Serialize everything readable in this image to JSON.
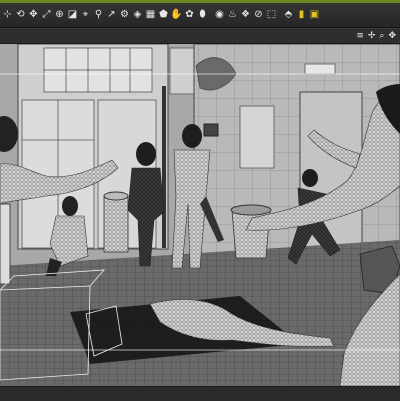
{
  "toolbar": {
    "tools": [
      {
        "name": "node-selection-tool",
        "glyph": "⊹"
      },
      {
        "name": "rotate-tool",
        "glyph": "⟲"
      },
      {
        "name": "translate-tool",
        "glyph": "✥"
      },
      {
        "name": "scale-tool",
        "glyph": "⤢"
      },
      {
        "name": "universal-tool",
        "glyph": "⊕"
      },
      {
        "name": "surface-selection-tool",
        "glyph": "◪"
      },
      {
        "name": "region-navigator-tool",
        "glyph": "⌖"
      },
      {
        "name": "active-pose-tool",
        "glyph": "⚲"
      },
      {
        "name": "pose-tool",
        "glyph": "↗"
      },
      {
        "name": "joint-editor-tool",
        "glyph": "⚙"
      },
      {
        "name": "geometry-editor-tool",
        "glyph": "◈"
      },
      {
        "name": "weight-map-tool",
        "glyph": "▦"
      },
      {
        "name": "morph-tool",
        "glyph": "⬟"
      },
      {
        "name": "spot-render-tool",
        "glyph": "✋"
      },
      {
        "name": "light-tool",
        "glyph": "✿"
      },
      {
        "name": "camera-tool",
        "glyph": "⬮"
      },
      {
        "name": "sphere-primitive-tool",
        "glyph": "◉"
      },
      {
        "name": "scene-tool",
        "glyph": "♨"
      },
      {
        "name": "render-tool",
        "glyph": "❖"
      },
      {
        "name": "gizmo-tool",
        "glyph": "⊘"
      },
      {
        "name": "render-settings-tool",
        "glyph": "⬚"
      },
      {
        "name": "save-tool",
        "glyph": "⬘"
      },
      {
        "name": "lock-tool",
        "glyph": "▮",
        "yellow": true
      },
      {
        "name": "camera-lock-tool",
        "glyph": "▣",
        "yellow": true
      }
    ]
  },
  "viewport_controls": [
    {
      "name": "viewport-menu-icon",
      "glyph": "≡"
    },
    {
      "name": "orbit-icon",
      "glyph": "✢"
    },
    {
      "name": "zoom-icon",
      "glyph": "⌕"
    },
    {
      "name": "pan-icon",
      "glyph": "✥"
    }
  ],
  "colors": {
    "accent": "#6b8a1f",
    "selection_yellow": "#e4c21d",
    "toolbar_bg": "#2b2b2b",
    "wire": "#202020"
  }
}
